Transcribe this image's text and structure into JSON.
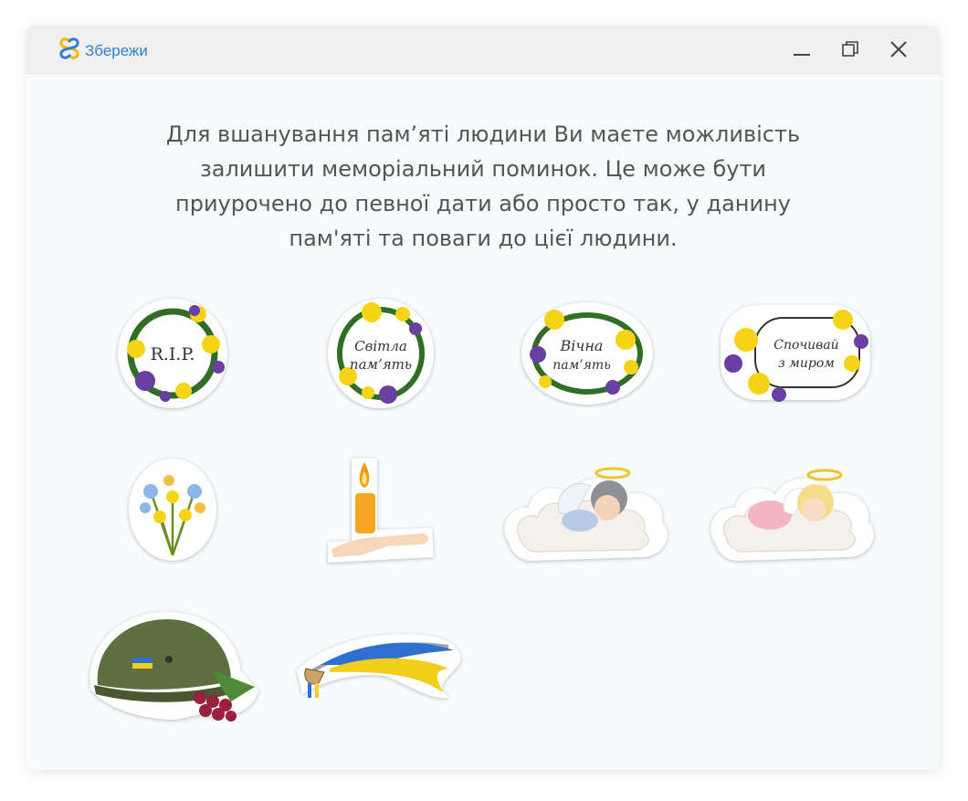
{
  "app": {
    "title": "Збережи"
  },
  "window_controls": {
    "minimize": "minimize-icon",
    "restore": "restore-icon",
    "close": "close-icon"
  },
  "intro": {
    "lines": [
      "Для вшанування пам’яті людини Ви маєте можливість",
      "залишити меморіальний поминок. Це може бути",
      "приурочено до певної дати або просто так, у данину",
      "пам'яті та поваги до цієї людини."
    ]
  },
  "stickers": {
    "rip": {
      "text": "R.I.P."
    },
    "svitla": {
      "line1": "Світла",
      "line2": "пам’ять"
    },
    "vichna": {
      "line1": "Вічна",
      "line2": "пам’ять"
    },
    "spochyvai": {
      "line1": "Спочивай",
      "line2": "з миром"
    },
    "icons": [
      "flowers-bouquet-icon",
      "candle-hand-icon",
      "angel-boy-cloud-icon",
      "angel-girl-cloud-icon",
      "military-helmet-viburnum-icon",
      "saber-ribbon-icon"
    ]
  },
  "colors": {
    "accent": "#2f7fd6",
    "intro_text": "#555555",
    "window_bg": "#f7fbfc",
    "titlebar_bg": "#f0f0f0"
  }
}
